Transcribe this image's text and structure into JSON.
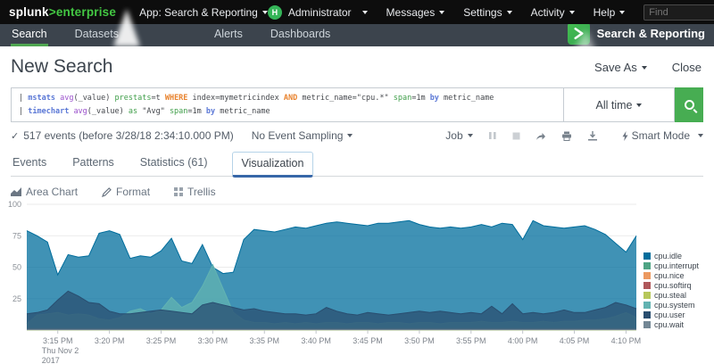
{
  "topbar": {
    "logo": {
      "part1": "splunk",
      "gt": ">",
      "part2": "enterprise"
    },
    "app_menu": "App: Search & Reporting",
    "avatar_letter": "H",
    "menus": [
      {
        "label": "Administrator"
      },
      {
        "label": "Messages"
      },
      {
        "label": "Settings"
      },
      {
        "label": "Activity"
      },
      {
        "label": "Help"
      }
    ],
    "find_placeholder": "Find"
  },
  "appbar": {
    "tabs": [
      {
        "label": "Search"
      },
      {
        "label": "Datasets"
      },
      {
        "label": "Alerts"
      },
      {
        "label": "Dashboards"
      }
    ],
    "app_label": "Search & Reporting"
  },
  "page": {
    "title": "New Search",
    "save_as": "Save As",
    "close": "Close"
  },
  "search": {
    "time_range": "All time",
    "query": {
      "colors": {
        "kw": "#5b78d6",
        "fn": "#9b52cc",
        "opt": "#3f9e49",
        "bool": "#e8822d",
        "plain": "#45484d"
      },
      "lines": [
        [
          [
            "| ",
            "plain"
          ],
          [
            "mstats",
            "kw"
          ],
          [
            " ",
            "plain"
          ],
          [
            "avg",
            "fn"
          ],
          [
            "(_value) ",
            "plain"
          ],
          [
            "prestats",
            "opt"
          ],
          [
            "=t ",
            "plain"
          ],
          [
            "WHERE",
            "bool"
          ],
          [
            " index=mymetricindex ",
            "plain"
          ],
          [
            "AND",
            "bool"
          ],
          [
            " metric_name=\"cpu.*\" ",
            "plain"
          ],
          [
            "span",
            "opt"
          ],
          [
            "=1m ",
            "plain"
          ],
          [
            "by",
            "kw"
          ],
          [
            " metric_name",
            "plain"
          ]
        ],
        [
          [
            "| ",
            "plain"
          ],
          [
            "timechart",
            "kw"
          ],
          [
            " ",
            "plain"
          ],
          [
            "avg",
            "fn"
          ],
          [
            "(_value) ",
            "plain"
          ],
          [
            "as",
            "opt"
          ],
          [
            " \"Avg\" ",
            "plain"
          ],
          [
            "span",
            "opt"
          ],
          [
            "=1m ",
            "plain"
          ],
          [
            "by",
            "kw"
          ],
          [
            " metric_name",
            "plain"
          ]
        ]
      ]
    }
  },
  "info": {
    "check_icon": "✓",
    "events_text": "517 events (before 3/28/18 2:34:10.000 PM)",
    "sampling": "No Event Sampling",
    "job": "Job",
    "smart_mode": "Smart Mode"
  },
  "results_tabs": [
    {
      "label": "Events"
    },
    {
      "label": "Patterns"
    },
    {
      "label": "Statistics (61)"
    },
    {
      "label": "Visualization"
    }
  ],
  "viz_controls": {
    "chart_type": "Area Chart",
    "format": "Format",
    "trellis": "Trellis"
  },
  "chart_data": {
    "type": "area",
    "stacked": false,
    "fill_opacity": 0.75,
    "ylim": [
      0,
      100
    ],
    "yticks": [
      25,
      50,
      75,
      100
    ],
    "x_minutes_span": 60,
    "x_start_time": "3:12 PM",
    "x_end_time": "4:11 PM",
    "x_tick_minutes": [
      3,
      8,
      13,
      18,
      23,
      28,
      33,
      38,
      43,
      48,
      53,
      58
    ],
    "x_tick_labels": [
      "3:15 PM",
      "3:20 PM",
      "3:25 PM",
      "3:30 PM",
      "3:35 PM",
      "3:40 PM",
      "3:45 PM",
      "3:50 PM",
      "3:55 PM",
      "4:00 PM",
      "4:05 PM",
      "4:10 PM"
    ],
    "first_tick_sublabels": [
      "Thu Nov 2",
      "2017"
    ],
    "series": [
      {
        "name": "cpu.idle",
        "color": "#006d9c",
        "values": [
          79,
          75,
          70,
          44,
          60,
          58,
          59,
          77,
          79,
          76,
          57,
          59,
          58,
          63,
          73,
          55,
          53,
          68,
          50,
          45,
          46,
          72,
          80,
          79,
          78,
          80,
          82,
          81,
          83,
          85,
          86,
          85,
          84,
          83,
          85,
          85,
          86,
          87,
          84,
          82,
          81,
          82,
          81,
          82,
          84,
          82,
          85,
          84,
          72,
          87,
          83,
          82,
          81,
          82,
          83,
          80,
          76,
          69,
          62,
          75
        ]
      },
      {
        "name": "cpu.interrupt",
        "color": "#4fa484",
        "constant": 0.3
      },
      {
        "name": "cpu.nice",
        "color": "#ec9960",
        "constant": 0.6
      },
      {
        "name": "cpu.softirq",
        "color": "#af575a",
        "constant": 1.2
      },
      {
        "name": "cpu.steal",
        "color": "#b6c75a",
        "constant": 0.2
      },
      {
        "name": "cpu.system",
        "color": "#62b3b2",
        "values": [
          5,
          12,
          13,
          14,
          12,
          13,
          12,
          9,
          8,
          10,
          15,
          17,
          13,
          16,
          26,
          18,
          22,
          35,
          52,
          33,
          14,
          8,
          6,
          6,
          5,
          6,
          5,
          6,
          5,
          6,
          6,
          5,
          6,
          6,
          5,
          6,
          6,
          5,
          6,
          6,
          5,
          6,
          6,
          6,
          7,
          6,
          6,
          7,
          6,
          6,
          7,
          6,
          7,
          7,
          8,
          8,
          9,
          11,
          14,
          10
        ]
      },
      {
        "name": "cpu.user",
        "color": "#294e70",
        "values": [
          13,
          14,
          16,
          24,
          31,
          27,
          22,
          21,
          15,
          13,
          13,
          14,
          15,
          16,
          15,
          14,
          13,
          20,
          22,
          20,
          18,
          16,
          17,
          15,
          14,
          13,
          13,
          12,
          13,
          18,
          15,
          13,
          12,
          14,
          13,
          12,
          13,
          14,
          15,
          14,
          15,
          14,
          13,
          14,
          13,
          19,
          13,
          21,
          13,
          14,
          13,
          14,
          16,
          14,
          14,
          16,
          18,
          22,
          20,
          17
        ]
      },
      {
        "name": "cpu.wait",
        "color": "#738795",
        "constant": 0.4
      }
    ]
  }
}
